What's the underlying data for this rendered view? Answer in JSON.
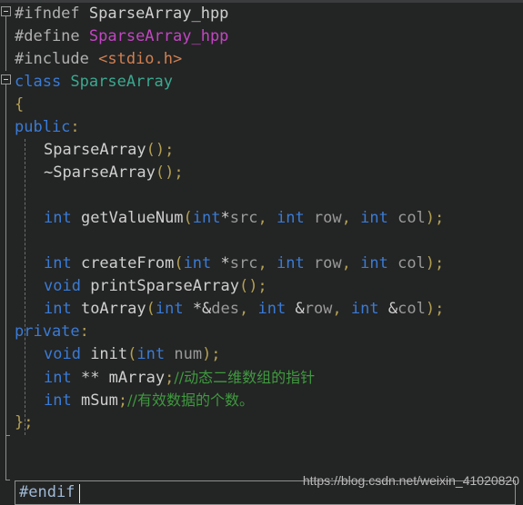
{
  "window": {
    "app": "code-editor",
    "theme_background": "#232424",
    "line_height_px": 25
  },
  "colors": {
    "background": "#232424",
    "preprocessor": "#b0b0b0",
    "macro": "#c246c2",
    "header": "#d08050",
    "keyword": "#3a7bd5",
    "class_name": "#3aa98f",
    "function": "#cfcfcf",
    "punctuation": "#b3a053",
    "parameter": "#9a9a9a",
    "comment": "#3f9a3f",
    "caret": "#e6e6e6",
    "gutter_line": "#8d8d8d"
  },
  "editor": {
    "lines": [
      {
        "n": 1,
        "indent": 0,
        "fold": "open",
        "tokens": [
          {
            "t": "#ifndef ",
            "c": "pp"
          },
          {
            "t": "SparseArray_hpp",
            "c": "plain"
          }
        ]
      },
      {
        "n": 2,
        "indent": 0,
        "fold": null,
        "tokens": [
          {
            "t": "#define ",
            "c": "pp"
          },
          {
            "t": "SparseArray_hpp",
            "c": "macro"
          }
        ]
      },
      {
        "n": 3,
        "indent": 0,
        "fold": null,
        "tokens": [
          {
            "t": "#include ",
            "c": "pp"
          },
          {
            "t": "<stdio.h>",
            "c": "hdr"
          }
        ]
      },
      {
        "n": 4,
        "indent": 0,
        "fold": "open",
        "tokens": [
          {
            "t": "class ",
            "c": "kw"
          },
          {
            "t": "SparseArray",
            "c": "type"
          }
        ]
      },
      {
        "n": 5,
        "indent": 0,
        "fold": null,
        "tokens": [
          {
            "t": "{",
            "c": "punc"
          }
        ]
      },
      {
        "n": 6,
        "indent": 0,
        "fold": null,
        "tokens": [
          {
            "t": "public",
            "c": "kw"
          },
          {
            "t": ":",
            "c": "punc"
          }
        ]
      },
      {
        "n": 7,
        "indent": 1,
        "fold": null,
        "tokens": [
          {
            "t": "SparseArray",
            "c": "fn"
          },
          {
            "t": "();",
            "c": "punc"
          }
        ]
      },
      {
        "n": 8,
        "indent": 1,
        "fold": null,
        "tokens": [
          {
            "t": "~",
            "c": "plain"
          },
          {
            "t": "SparseArray",
            "c": "fn"
          },
          {
            "t": "();",
            "c": "punc"
          }
        ]
      },
      {
        "n": 9,
        "indent": 1,
        "fold": null,
        "tokens": []
      },
      {
        "n": 10,
        "indent": 1,
        "fold": null,
        "tokens": [
          {
            "t": "int ",
            "c": "kw"
          },
          {
            "t": "getValueNum",
            "c": "fn"
          },
          {
            "t": "(",
            "c": "punc"
          },
          {
            "t": "int",
            "c": "kw"
          },
          {
            "t": "*",
            "c": "plain"
          },
          {
            "t": "src",
            "c": "param"
          },
          {
            "t": ", ",
            "c": "punc"
          },
          {
            "t": "int ",
            "c": "kw"
          },
          {
            "t": "row",
            "c": "param"
          },
          {
            "t": ", ",
            "c": "punc"
          },
          {
            "t": "int ",
            "c": "kw"
          },
          {
            "t": "col",
            "c": "param"
          },
          {
            "t": ");",
            "c": "punc"
          }
        ]
      },
      {
        "n": 11,
        "indent": 1,
        "fold": null,
        "tokens": []
      },
      {
        "n": 12,
        "indent": 1,
        "fold": null,
        "tokens": [
          {
            "t": "int ",
            "c": "kw"
          },
          {
            "t": "createFrom",
            "c": "fn"
          },
          {
            "t": "(",
            "c": "punc"
          },
          {
            "t": "int ",
            "c": "kw"
          },
          {
            "t": "*",
            "c": "plain"
          },
          {
            "t": "src",
            "c": "param"
          },
          {
            "t": ", ",
            "c": "punc"
          },
          {
            "t": "int ",
            "c": "kw"
          },
          {
            "t": "row",
            "c": "param"
          },
          {
            "t": ", ",
            "c": "punc"
          },
          {
            "t": "int ",
            "c": "kw"
          },
          {
            "t": "col",
            "c": "param"
          },
          {
            "t": ");",
            "c": "punc"
          }
        ]
      },
      {
        "n": 13,
        "indent": 1,
        "fold": null,
        "tokens": [
          {
            "t": "void ",
            "c": "kw"
          },
          {
            "t": "printSparseArray",
            "c": "fn"
          },
          {
            "t": "();",
            "c": "punc"
          }
        ]
      },
      {
        "n": 14,
        "indent": 1,
        "fold": null,
        "tokens": [
          {
            "t": "int ",
            "c": "kw"
          },
          {
            "t": "toArray",
            "c": "fn"
          },
          {
            "t": "(",
            "c": "punc"
          },
          {
            "t": "int ",
            "c": "kw"
          },
          {
            "t": "*&",
            "c": "plain"
          },
          {
            "t": "des",
            "c": "param"
          },
          {
            "t": ", ",
            "c": "punc"
          },
          {
            "t": "int ",
            "c": "kw"
          },
          {
            "t": "&",
            "c": "plain"
          },
          {
            "t": "row",
            "c": "param"
          },
          {
            "t": ", ",
            "c": "punc"
          },
          {
            "t": "int ",
            "c": "kw"
          },
          {
            "t": "&",
            "c": "plain"
          },
          {
            "t": "col",
            "c": "param"
          },
          {
            "t": ");",
            "c": "punc"
          }
        ]
      },
      {
        "n": 15,
        "indent": 0,
        "fold": null,
        "tokens": [
          {
            "t": "private",
            "c": "kw"
          },
          {
            "t": ":",
            "c": "punc"
          }
        ]
      },
      {
        "n": 16,
        "indent": 1,
        "fold": null,
        "tokens": [
          {
            "t": "void ",
            "c": "kw"
          },
          {
            "t": "init",
            "c": "fn"
          },
          {
            "t": "(",
            "c": "punc"
          },
          {
            "t": "int ",
            "c": "kw"
          },
          {
            "t": "num",
            "c": "param"
          },
          {
            "t": ");",
            "c": "punc"
          }
        ]
      },
      {
        "n": 17,
        "indent": 1,
        "fold": null,
        "tokens": [
          {
            "t": "int ",
            "c": "kw"
          },
          {
            "t": "** ",
            "c": "plain"
          },
          {
            "t": "mArray",
            "c": "fn"
          },
          {
            "t": ";",
            "c": "punc"
          },
          {
            "t": "//动态二维数组的指针",
            "c": "cmt"
          }
        ]
      },
      {
        "n": 18,
        "indent": 1,
        "fold": null,
        "tokens": [
          {
            "t": "int ",
            "c": "kw"
          },
          {
            "t": "mSum",
            "c": "fn"
          },
          {
            "t": ";",
            "c": "punc"
          },
          {
            "t": "//有效数据的个数。",
            "c": "cmt"
          }
        ]
      },
      {
        "n": 19,
        "indent": 0,
        "fold": null,
        "tokens": [
          {
            "t": "};",
            "c": "punc"
          }
        ]
      },
      {
        "n": 20,
        "indent": 0,
        "fold": null,
        "tokens": []
      },
      {
        "n": 21,
        "indent": 0,
        "fold": null,
        "tokens": []
      },
      {
        "n": 22,
        "indent": 0,
        "fold": null,
        "tokens": []
      }
    ],
    "current_line": {
      "text": "#endif",
      "caret_visible": true
    }
  },
  "watermark": {
    "text": "https://blog.csdn.net/weixin_41020820"
  }
}
